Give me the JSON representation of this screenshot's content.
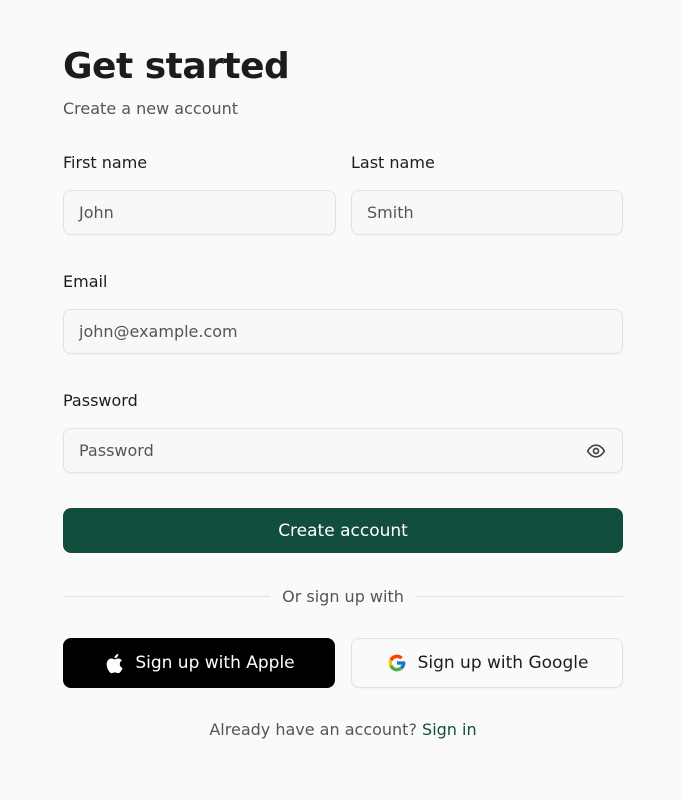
{
  "header": {
    "title": "Get started",
    "subtitle": "Create a new account"
  },
  "form": {
    "first_name": {
      "label": "First name",
      "value": "John"
    },
    "last_name": {
      "label": "Last name",
      "value": "Smith"
    },
    "email": {
      "label": "Email",
      "value": "john@example.com"
    },
    "password": {
      "label": "Password",
      "placeholder": "Password",
      "toggle_icon": "eye-icon"
    }
  },
  "actions": {
    "create_label": "Create account",
    "divider_text": "Or sign up with",
    "apple_label": "Sign up with Apple",
    "google_label": "Sign up with Google"
  },
  "footer": {
    "prompt": "Already have an account?",
    "link": "Sign in"
  },
  "colors": {
    "primary": "#114e3e",
    "apple_bg": "#000000",
    "background": "#fafafa"
  }
}
